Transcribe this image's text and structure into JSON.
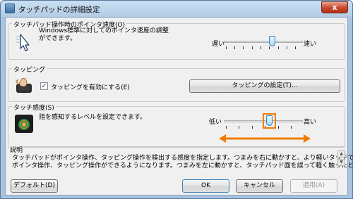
{
  "window": {
    "title": "タッチパッドの詳細設定",
    "close_glyph": "x"
  },
  "speed": {
    "legend": "タッチパッド操作時のポインタ速度(O)",
    "description": "Windows標準に対してのポインタ速度の調整\nができます。",
    "slow_label": "遅い",
    "fast_label": "速い",
    "slider_value": 0.5
  },
  "tapping": {
    "legend": "タッピング",
    "checkbox_label": "タッピングを有効にする(E)",
    "checked": true,
    "settings_button": "タッピングの設定(T)..."
  },
  "sensitivity": {
    "legend": "タッチ感度(S)",
    "description": "指を感知するレベルを設定できます。",
    "low_label": "低い",
    "high_label": "高い",
    "slider_value": 0.5
  },
  "explanation": {
    "legend": "説明",
    "text_line1": "タッチパッドがポインタ操作、タッピング操作を検出する感度を指定します。つまみを右に動かすと、より軽いタッチで",
    "text_line2": "ポインタ操作、タッピング操作ができるようになります。つまみを左に動かすと、タッチパッド面を誤って軽く触ったときの"
  },
  "buttons": {
    "default": "デフォルト(D)",
    "ok": "OK",
    "cancel": "キャンセル",
    "apply": "適用(A)"
  },
  "colors": {
    "highlight": "#f07d00",
    "title_blue": "#b4cde6"
  }
}
